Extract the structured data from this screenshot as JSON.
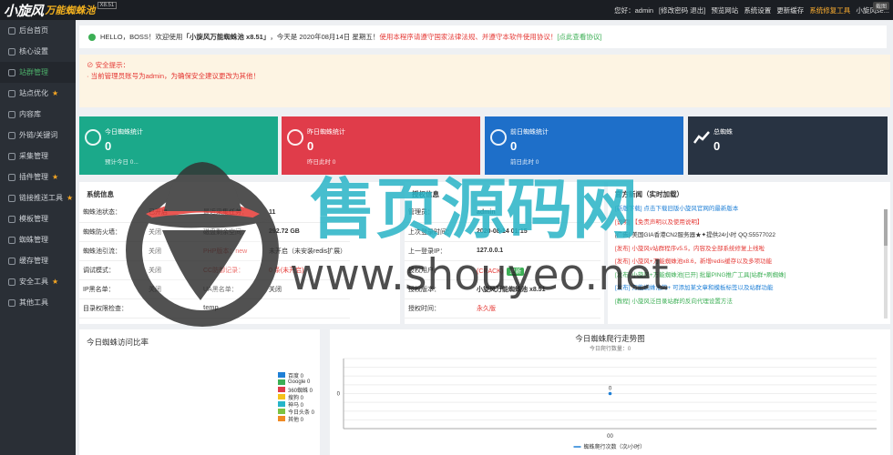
{
  "topbar": {
    "logo_main": "小旋风",
    "logo_sub": "万能蜘蛛池",
    "logo_version": "X8.51",
    "greeting": "您好：admin",
    "nav": [
      "[修改密码 退出]",
      "预览网站",
      "系统设置",
      "更新缓存",
      "系统修复工具",
      "小旋风se..."
    ],
    "tooltip": "截图"
  },
  "sidebar": {
    "items": [
      {
        "label": "后台首页",
        "star": false
      },
      {
        "label": "核心设置",
        "star": false
      },
      {
        "label": "站群管理",
        "star": false,
        "active": true
      },
      {
        "label": "站点优化",
        "star": true
      },
      {
        "label": "内容库",
        "star": false
      },
      {
        "label": "外链/关键词",
        "star": false
      },
      {
        "label": "采集管理",
        "star": false
      },
      {
        "label": "插件管理",
        "star": true
      },
      {
        "label": "链接推送工具",
        "star": true
      },
      {
        "label": "模板管理",
        "star": false
      },
      {
        "label": "蜘蛛管理",
        "star": false
      },
      {
        "label": "缓存管理",
        "star": false
      },
      {
        "label": "安全工具",
        "star": true
      },
      {
        "label": "其他工具",
        "star": false
      }
    ]
  },
  "notice": {
    "prefix": "HELLO，BOSS！欢迎使用",
    "product": "「小旋风万能蜘蛛池 x8.51」",
    "date_text": "，今天是 2020年08月14日 星期五！",
    "legal": "使用本程序请遵守国家法律法规、并遵守本软件使用协议！",
    "link": "[点此查看协议]"
  },
  "warning": {
    "title": "安全提示：",
    "text": "· 当前管理员账号为admin，为确保安全建议更改为其他！"
  },
  "cards": [
    {
      "title": "今日蜘蛛统计",
      "value": "0",
      "sub": "预计今日 0...",
      "color": "#1ba98a"
    },
    {
      "title": "昨日蜘蛛统计",
      "value": "0",
      "sub": "昨日此时 0",
      "color": "#e03c4a"
    },
    {
      "title": "前日蜘蛛统计",
      "value": "0",
      "sub": "前日此时 0",
      "color": "#1e6fc9"
    },
    {
      "title": "总蜘蛛",
      "value": "0",
      "sub": "",
      "color": "#283342"
    }
  ],
  "sysinfo": {
    "title": "系统信息",
    "rows": [
      [
        "蜘蛛池状态：",
        "已开启",
        "最近采集任务：",
        "11"
      ],
      [
        "蜘蛛防火墙：",
        "关闭",
        "磁盘剩余空间：",
        "292.72 GB"
      ],
      [
        "蜘蛛池引流：",
        "关闭",
        "PHP版本：new",
        "未开启（未安装redis扩展）"
      ],
      [
        "调试模式：",
        "关闭",
        "CC防御记录：",
        "0 条(未开启)"
      ],
      [
        "IP黑名单：",
        "关闭",
        "UA黑名单：",
        "关闭"
      ],
      [
        "目录权限检查：",
        "",
        "temp",
        ""
      ]
    ]
  },
  "auth": {
    "title": "授权信息",
    "rows": [
      [
        "管理员：",
        "admin"
      ],
      [
        "上次登录时间：",
        "2020-08-14 01:15"
      ],
      [
        "上一登录IP：",
        "127.0.0.1"
      ],
      [
        "授权用户：",
        "(CRACK)"
      ],
      [
        "授权版本：",
        "小旋风万能蜘蛛池 x8.51"
      ],
      [
        "授权时间：",
        "永久版"
      ]
    ],
    "update": "更新"
  },
  "news": {
    "title": "官方新闻（实时加载）",
    "items": [
      {
        "text": "[新版下载] 点击下载旧版小旋风官网的最新版本",
        "c": "b"
      },
      {
        "text": "[说明] 【免责声明以及使用说明】",
        "c": "r"
      },
      {
        "text": "[广告] 美国GIA香港CN2服务器★✦提供24小时 QQ:55577022",
        "c": ""
      },
      {
        "text": "[发布] 小旋风v站群程序v5.5，内容及全部系统修复上线啦",
        "c": "r"
      },
      {
        "text": "[发布] 小旋风+万能蜘蛛池x8.6，新增redis缓存以及多项功能",
        "c": "r"
      },
      {
        "text": "[发布] 小旋风+万能蜘蛛池[已开] 批量PING推广工具[站群+刷蜘蛛]",
        "c": "g"
      },
      {
        "text": "[发布] 万能蜘蛛池的+ 可添加某文章和模板标签以及站群功能",
        "c": "b"
      },
      {
        "text": "[教程] 小旋风泛目录站群的反向代理设置方法",
        "c": "g"
      }
    ]
  },
  "pie_panel": {
    "title": "今日蜘蛛访问比率",
    "legend": [
      {
        "name": "百度 0",
        "color": "#1e7fd6"
      },
      {
        "name": "Google 0",
        "color": "#3caf55"
      },
      {
        "name": "360蜘蛛 0",
        "color": "#e03c4a"
      },
      {
        "name": "搜狗 0",
        "color": "#f5c21b"
      },
      {
        "name": "神马 0",
        "color": "#26b5c9"
      },
      {
        "name": "今日头条 0",
        "color": "#7cc242"
      },
      {
        "name": "其他 0",
        "color": "#f08a24"
      }
    ]
  },
  "chart_data": {
    "type": "line",
    "title": "今日蜘蛛爬行走势图",
    "subtitle": "今日爬行数量：0",
    "categories": [
      "00"
    ],
    "series": [
      {
        "name": "蜘蛛爬行次数（次/小时）",
        "values": [
          0
        ]
      }
    ],
    "yticks": [
      "0"
    ],
    "point_label": "0",
    "grid": true
  },
  "watermark": {
    "cn": "售页源码网",
    "url": "www.shouyeo.net"
  }
}
